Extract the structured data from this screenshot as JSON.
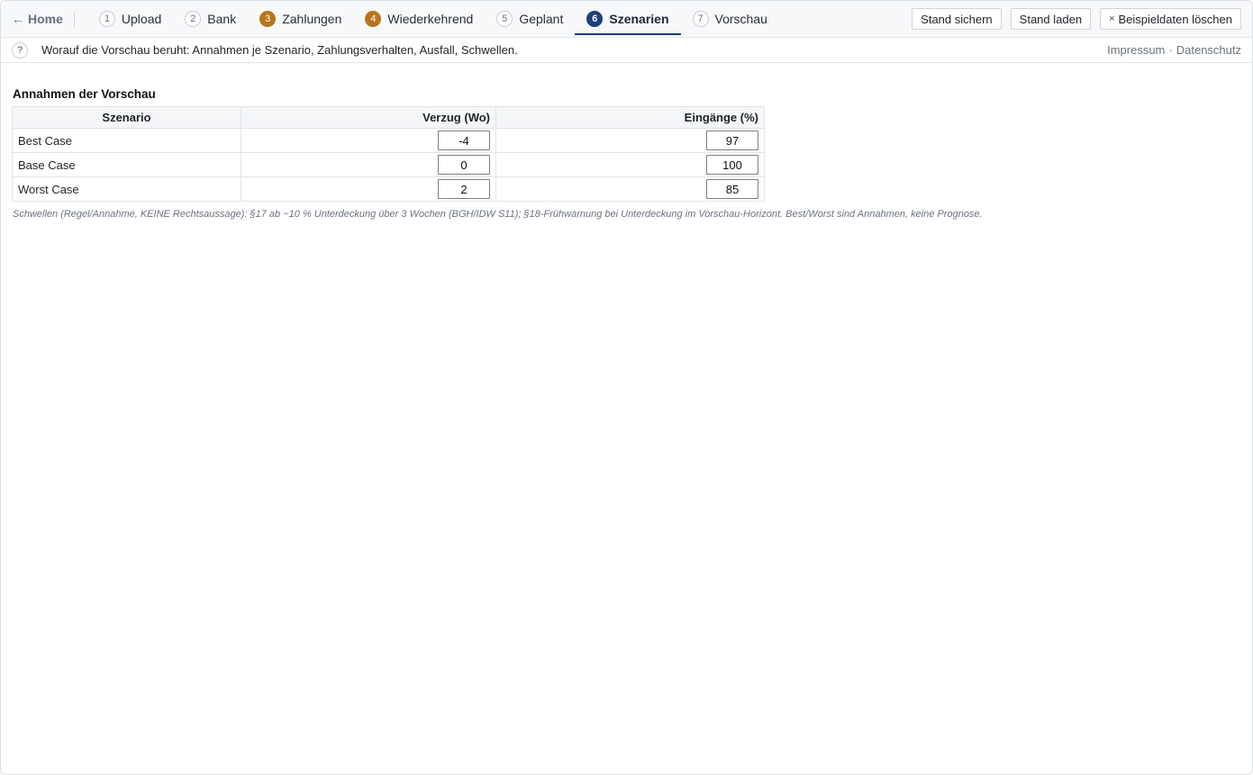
{
  "nav": {
    "home_arrow": "←",
    "home_label": "Home",
    "steps": [
      {
        "num": "1",
        "label": "Upload"
      },
      {
        "num": "2",
        "label": "Bank"
      },
      {
        "num": "3",
        "label": "Zahlungen"
      },
      {
        "num": "4",
        "label": "Wiederkehrend"
      },
      {
        "num": "5",
        "label": "Geplant"
      },
      {
        "num": "6",
        "label": "Szenarien"
      },
      {
        "num": "7",
        "label": "Vorschau"
      }
    ],
    "active_step": "Szenarien",
    "actions": {
      "save_label": "Stand sichern",
      "load_label": "Stand laden",
      "clear_icon": "×",
      "clear_label": "Beispieldaten löschen"
    }
  },
  "info": {
    "help_icon": "?",
    "text": "Worauf die Vorschau beruht: Annahmen je Szenario, Zahlungsverhalten, Ausfall, Schwellen.",
    "legal_imprint": "Impressum",
    "legal_separator": "·",
    "legal_privacy": "Datenschutz"
  },
  "assumptions": {
    "title": "Annahmen der Vorschau",
    "headers": {
      "scenario": "Szenario",
      "delay": "Verzug (Wo)",
      "receipts": "Eingänge (%)"
    },
    "rows": [
      {
        "name": "Best Case",
        "delay": "-4",
        "receipts": "97"
      },
      {
        "name": "Base Case",
        "delay": "0",
        "receipts": "100"
      },
      {
        "name": "Worst Case",
        "delay": "2",
        "receipts": "85"
      }
    ],
    "footnote": "Schwellen (Regel/Annahme, KEINE Rechtsaussage): §17 ab ~10 % Unterdeckung über 3 Wochen (BGH/IDW S11); §18-Frühwarnung bei Unterdeckung im Vorschau-Horizont. Best/Worst sind Annahmen, keine Prognose."
  },
  "colors": {
    "active_step": "#1d3f7a",
    "completed_step": "#b8741a"
  }
}
